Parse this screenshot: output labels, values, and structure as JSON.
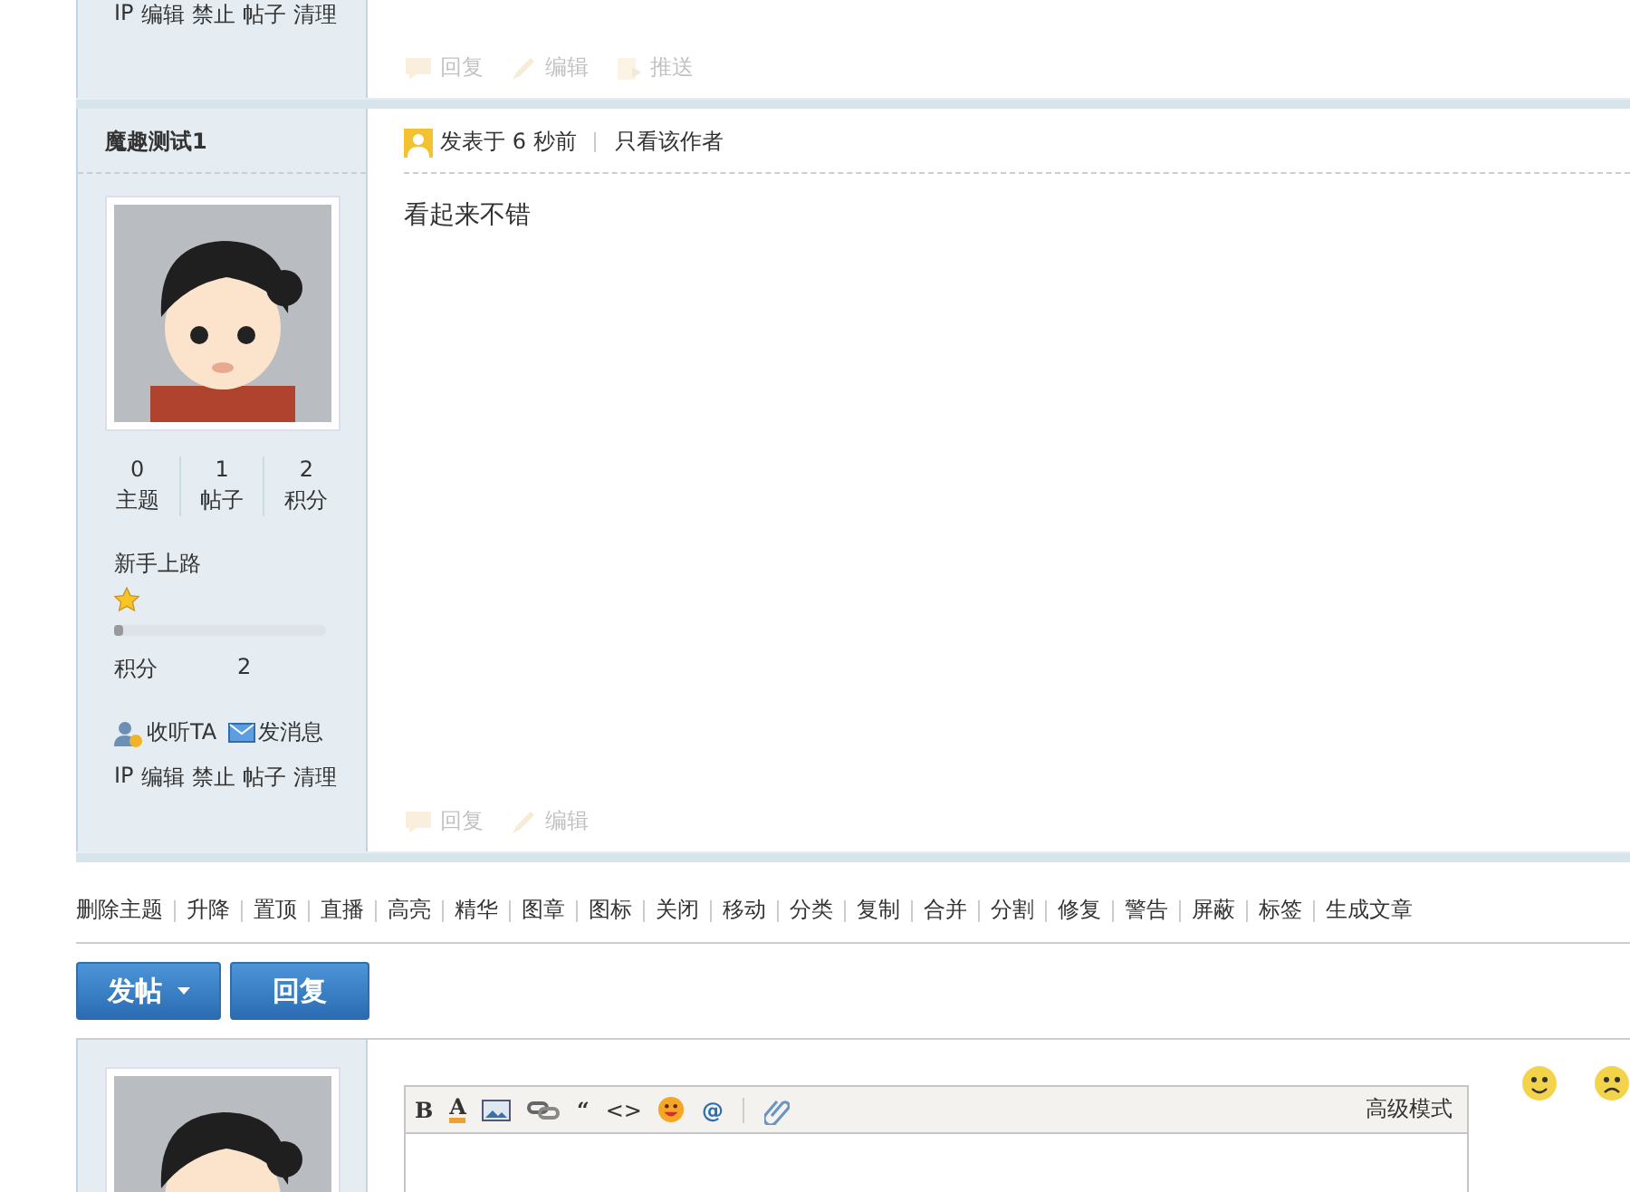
{
  "previous_post": {
    "user_links": [
      "IP",
      "编辑",
      "禁止",
      "帖子",
      "清理"
    ],
    "actions": [
      {
        "kind": "reply",
        "label": "回复",
        "disabled": true
      },
      {
        "kind": "edit",
        "label": "编辑",
        "disabled": true
      },
      {
        "kind": "push",
        "label": "推送",
        "disabled": true
      }
    ]
  },
  "post": {
    "author": "魔趣测试1",
    "posted": "发表于 6 秒前",
    "author_only": "只看该作者",
    "content": "看起来不错",
    "stats": [
      {
        "value": "0",
        "label": "主题"
      },
      {
        "value": "1",
        "label": "帖子"
      },
      {
        "value": "2",
        "label": "积分"
      }
    ],
    "rank": "新手上路",
    "level": 0.03,
    "points_label": "积分",
    "points": "2",
    "follow": "收听TA",
    "message": "发消息",
    "user_links": [
      "IP",
      "编辑",
      "禁止",
      "帖子",
      "清理"
    ],
    "actions": [
      {
        "kind": "reply",
        "label": "回复",
        "disabled": true
      },
      {
        "kind": "edit",
        "label": "编辑",
        "disabled": true
      }
    ]
  },
  "mod_actions": [
    "删除主题",
    "升降",
    "置顶",
    "直播",
    "高亮",
    "精华",
    "图章",
    "图标",
    "关闭",
    "移动",
    "分类",
    "复制",
    "合并",
    "分割",
    "修复",
    "警告",
    "屏蔽",
    "标签",
    "生成文章"
  ],
  "buttons": [
    {
      "kind": "new_thread",
      "label": "发帖"
    },
    {
      "kind": "reply",
      "label": "回复"
    }
  ],
  "editor": {
    "toolbar": [
      {
        "kind": "bold",
        "label": "B"
      },
      {
        "kind": "color",
        "label": "A"
      },
      {
        "kind": "image"
      },
      {
        "kind": "link"
      },
      {
        "kind": "quote",
        "label": "“"
      },
      {
        "kind": "code",
        "label": "<>"
      },
      {
        "kind": "smiley"
      },
      {
        "kind": "at",
        "label": "@"
      },
      {
        "kind": "divider"
      },
      {
        "kind": "attach"
      }
    ],
    "mode": "高级模式"
  }
}
